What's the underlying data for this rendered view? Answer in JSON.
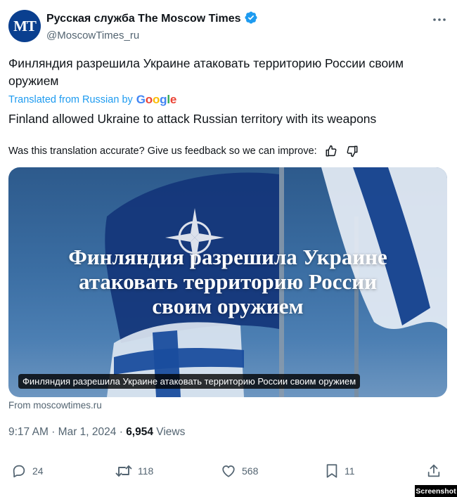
{
  "author": {
    "avatar_text": "MT",
    "display_name": "Русская служба The Moscow Times",
    "handle": "@MoscowTimes_ru",
    "verified_icon": "verified-badge-icon",
    "avatar_color": "#0a3f8f"
  },
  "tweet": {
    "text": "Финляндия разрешила Украине атаковать территорию России своим оружием",
    "translated_label": "Translated from Russian by",
    "translator": "Google",
    "translation": "Finland allowed Ukraine to attack Russian territory with its weapons",
    "feedback_prompt": "Was this translation accurate? Give us feedback so we can improve:"
  },
  "card": {
    "headline_line1": "Финляндия разрешила Украине",
    "headline_line2": "атаковать территорию России",
    "headline_line3": "своим оружием",
    "caption": "Финляндия разрешила Украине атаковать территорию России своим оружием",
    "source": "From moscowtimes.ru"
  },
  "meta": {
    "time": "9:17 AM",
    "separator": "·",
    "date": "Mar 1, 2024",
    "views_count": "6,954",
    "views_label": "Views"
  },
  "actions": {
    "replies": "24",
    "reposts": "118",
    "likes": "568",
    "bookmarks": "11"
  },
  "badge": "Screenshot",
  "colors": {
    "link": "#1d9bf0",
    "secondary_text": "#536471",
    "primary_text": "#0f1419"
  }
}
